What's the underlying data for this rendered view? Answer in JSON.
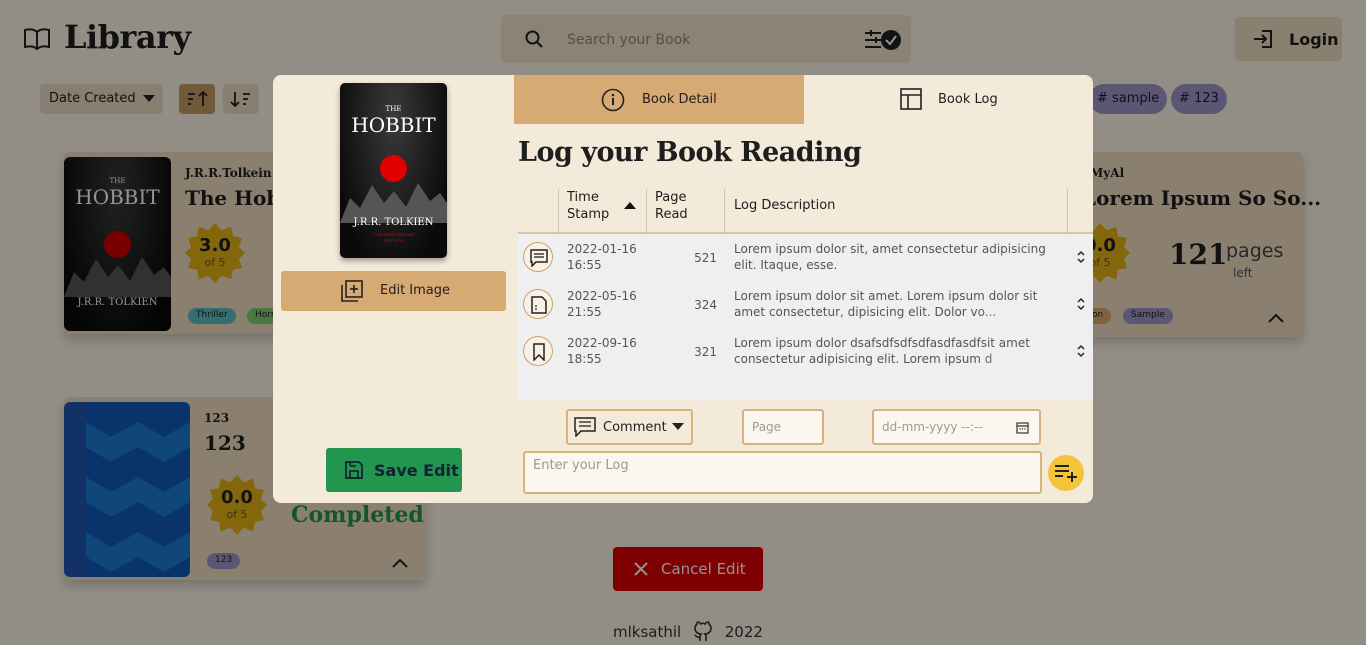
{
  "header": {
    "app_title": "Library",
    "search_placeholder": "Search your Book",
    "login_label": "Login"
  },
  "toolbar": {
    "sort_by": "Date Created",
    "tags": [
      "# sample",
      "# 123"
    ]
  },
  "cards": [
    {
      "author": "J.R.R.Tolkein",
      "title": "The Hobbit",
      "rating": "3.0",
      "rating_of": "of 5",
      "tags": [
        "Thriller",
        "Horror"
      ]
    },
    {
      "author": "MyAl",
      "title": "Lorem Ipsum So So...",
      "rating": "0.0",
      "rating_of": "of 5",
      "pages_left_num": "121",
      "pages_left_word": "pages",
      "pages_left_suffix": "left",
      "tags": [
        "Fiction",
        "Sample"
      ]
    },
    {
      "author": "123",
      "title": "123",
      "rating": "0.0",
      "rating_of": "of 5",
      "status": "Completed",
      "tags": [
        "123"
      ]
    }
  ],
  "cancel_label": "Cancel Edit",
  "footer": {
    "author": "mlksathil",
    "year": "2022"
  },
  "modal": {
    "cover": {
      "title_small": "THE",
      "title": "HOBBIT",
      "author": "J.R.R. TOLKIEN",
      "edition_line1": "75th ANNIVERSARY",
      "edition_line2": "EDITION"
    },
    "edit_image_label": "Edit Image",
    "save_label": "Save Edit",
    "tabs": [
      {
        "label": "Book Detail",
        "active": true
      },
      {
        "label": "Book Log",
        "active": false
      }
    ],
    "heading": "Log your Book Reading",
    "columns": {
      "timestamp_line1": "Time",
      "timestamp_line2": "Stamp",
      "page_line1": "Page",
      "page_line2": "Read",
      "description": "Log Description"
    },
    "logs": [
      {
        "icon": "comment-icon",
        "date": "2022-01-16",
        "time": "16:55",
        "page": "521",
        "description": "Lorem ipsum dolor sit, amet consectetur adipisicing elit. Itaque, esse."
      },
      {
        "icon": "note-icon",
        "date": "2022-05-16",
        "time": "21:55",
        "page": "324",
        "description": "Lorem ipsum dolor sit amet. Lorem ipsum dolor sit amet consectetur, dipisicing elit. Dolor vo..."
      },
      {
        "icon": "bookmark-icon",
        "date": "2022-09-16",
        "time": "18:55",
        "page": "321",
        "description": "Lorem ipsum dolor dsafsdfsdfsdfasdfasdfsit amet consectetur adipisicing elit. Lorem ipsum d"
      }
    ],
    "form": {
      "type_value": "Comment",
      "page_placeholder": "Page",
      "date_placeholder": "dd-mm-yyyy --:--",
      "log_placeholder": "Enter your Log"
    },
    "colors": {
      "accent": "#d8aa73",
      "save": "#22954f",
      "cancel": "#d90000",
      "add": "#f3c33a"
    }
  }
}
